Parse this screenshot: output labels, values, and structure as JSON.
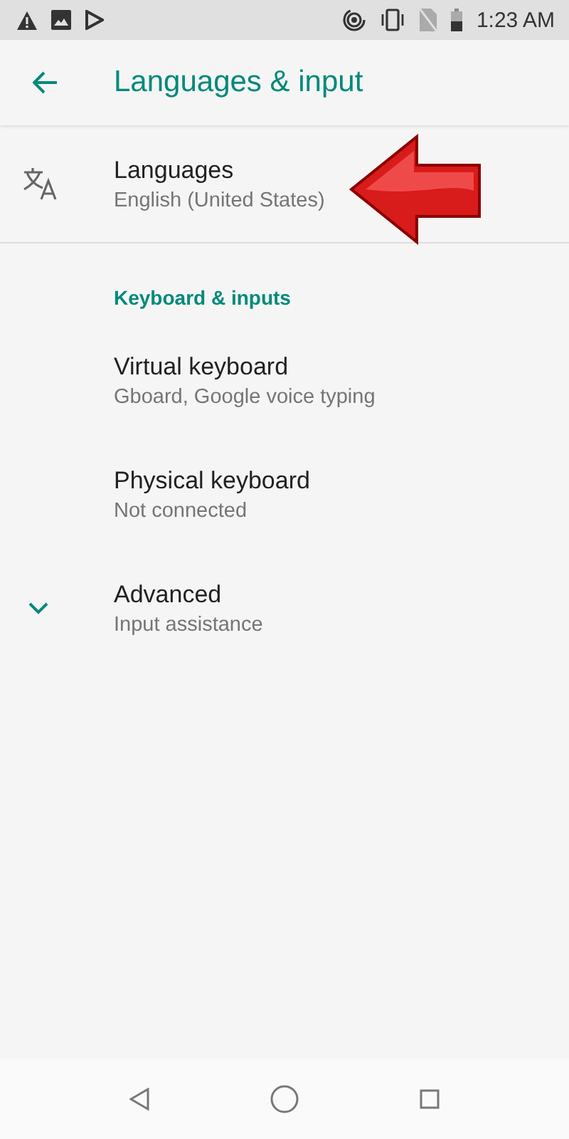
{
  "status_bar": {
    "time": "1:23 AM"
  },
  "app_bar": {
    "title": "Languages & input"
  },
  "top_item": {
    "title": "Languages",
    "summary": "English (United States)",
    "kind": "translate"
  },
  "section": {
    "header": "Keyboard & inputs",
    "items": [
      {
        "title": "Virtual keyboard",
        "summary": "Gboard, Google voice typing",
        "kind": "plain"
      },
      {
        "title": "Physical keyboard",
        "summary": "Not connected",
        "kind": "plain"
      },
      {
        "title": "Advanced",
        "summary": "Input assistance",
        "kind": "expand"
      }
    ]
  }
}
